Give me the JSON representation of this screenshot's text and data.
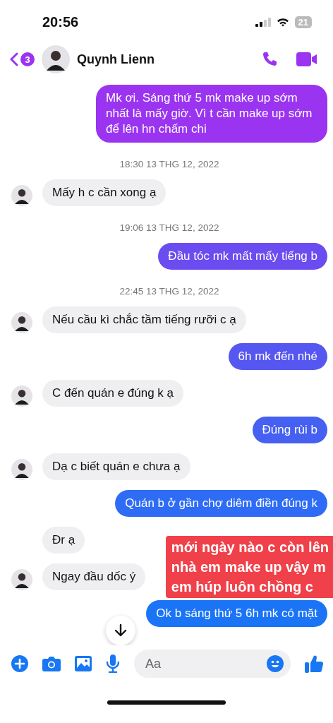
{
  "status_bar": {
    "time": "20:56",
    "battery": "21"
  },
  "header": {
    "unread_badge": "3",
    "name": "Quynh Lienn"
  },
  "messages": [
    {
      "kind": "out",
      "text": "Mk ơi. Sáng thứ 5 mk make up sớm nhất là mấy giờ. Vì t cần make up sớm để lên hn chấm chi",
      "color": "#9b34f0"
    },
    {
      "kind": "time",
      "text": "18:30 13 THG 12, 2022"
    },
    {
      "kind": "in",
      "text": "Mấy h c cần xong ạ",
      "avatar": true
    },
    {
      "kind": "time",
      "text": "19:06 13 THG 12, 2022"
    },
    {
      "kind": "out",
      "text": "Đầu tóc mk mất mấy tiếng b",
      "color": "#6a4cf0"
    },
    {
      "kind": "time",
      "text": "22:45 13 THG 12, 2022"
    },
    {
      "kind": "in",
      "text": "Nếu cầu kì chắc tầm tiếng rưỡi c ạ",
      "avatar": true
    },
    {
      "kind": "out",
      "text": "6h mk đến nhé",
      "color": "#5656f0"
    },
    {
      "kind": "in",
      "text": "C đến quán e đúng k ạ",
      "avatar": true
    },
    {
      "kind": "out",
      "text": "Đúng rùi b",
      "color": "#4660f2"
    },
    {
      "kind": "in",
      "text": "Dạ c biết quán e chưa ạ",
      "avatar": true
    },
    {
      "kind": "out",
      "text": "Quán b ở gần chợ diêm điền đúng k",
      "color": "#2f6cf5"
    },
    {
      "kind": "in",
      "text": "Đr ạ",
      "avatar": false
    },
    {
      "kind": "in",
      "text": "Ngay đầu dốc ý",
      "avatar": true
    },
    {
      "kind": "out",
      "text": "Ok b sáng thứ 5 6h mk có mặt",
      "color": "#1b74f5"
    }
  ],
  "caption": [
    "mới ngày nào c còn lên",
    "nhà em make up vậy m",
    "em húp luôn chồng c"
  ],
  "composer": {
    "placeholder": "Aa"
  }
}
